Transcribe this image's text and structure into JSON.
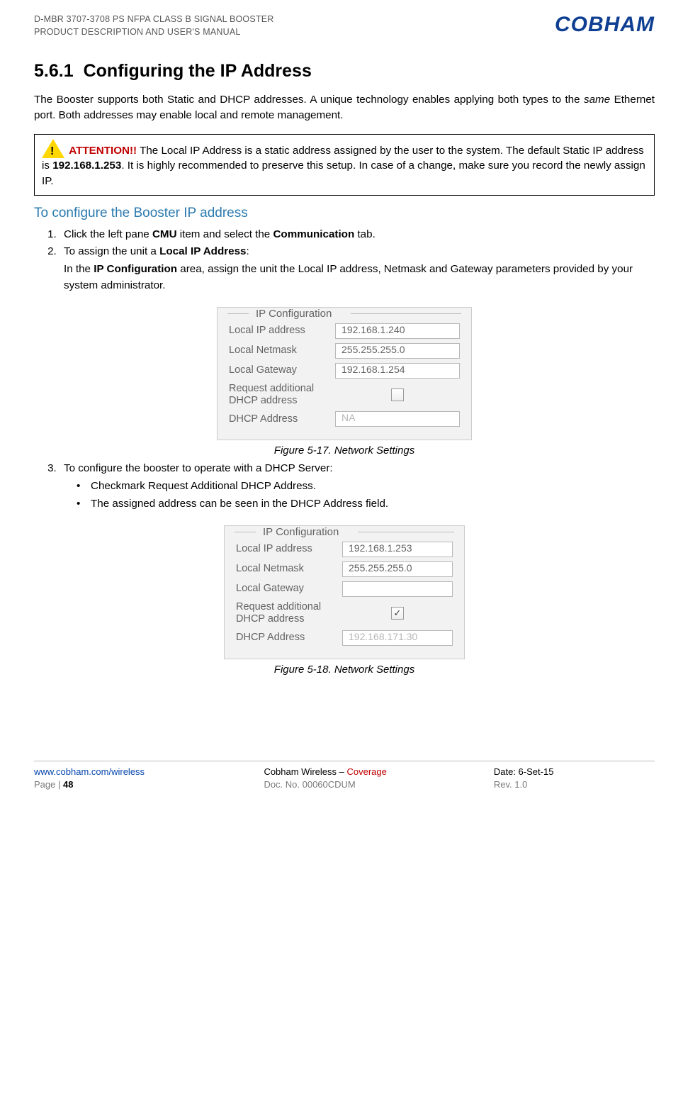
{
  "header": {
    "line1": "D-MBR 3707-3708 PS NFPA CLASS B SIGNAL BOOSTER",
    "line2": "PRODUCT DESCRIPTION AND USER'S MANUAL",
    "logo": "COBHAM"
  },
  "section": {
    "number": "5.6.1",
    "title": "Configuring the IP Address",
    "intro_a": "The Booster supports both Static and DHCP addresses. A unique technology enables applying both types to the ",
    "intro_same": "same",
    "intro_b": " Ethernet port. Both addresses may enable local and remote management."
  },
  "attention": {
    "label": "ATTENTION!!",
    "text_a": " The Local IP Address is a static address assigned by the user to the system. The default Static IP address is ",
    "ip_bold": "192.168.1.253",
    "text_b": ". It is highly recommended to preserve this setup. In case of a change, make sure you record the newly assign IP."
  },
  "subheading": "To configure the Booster IP address",
  "steps": {
    "s1_a": "Click the left pane ",
    "s1_cmu": "CMU",
    "s1_b": " item and select the ",
    "s1_comm": "Communication",
    "s1_c": " tab.",
    "s2_a": "To assign the unit a ",
    "s2_lip": "Local IP Address",
    "s2_b": ":",
    "s2_block_a": "In the ",
    "s2_ipconf": "IP Configuration",
    "s2_block_b": " area, assign the unit the Local IP address, Netmask and Gateway parameters provided by your system administrator.",
    "s3": "To configure the booster to operate with a DHCP Server:",
    "b1": "Checkmark Request Additional DHCP Address.",
    "b2": "The assigned address can be seen in the DHCP Address field."
  },
  "figcap1": "Figure 5-17. Network Settings",
  "figcap2": "Figure 5-18. Network Settings",
  "ipbox": {
    "legend": "IP Configuration",
    "l_ip": "Local IP address",
    "l_nm": "Local Netmask",
    "l_gw": "Local Gateway",
    "l_req": "Request additional DHCP address",
    "l_dhcp": "DHCP Address"
  },
  "fig1": {
    "ip": "192.168.1.240",
    "nm": "255.255.255.0",
    "gw": "192.168.1.254",
    "dhcp": "NA",
    "checked": ""
  },
  "fig2": {
    "ip": "192.168.1.253",
    "nm": "255.255.255.0",
    "gw": "",
    "dhcp": "192.168.171.30",
    "checked": "✓"
  },
  "footer": {
    "url": "www.cobham.com/wireless",
    "mid1a": "Cobham Wireless",
    "mid1b": " – ",
    "mid1c": "Coverage",
    "date": "Date: 6-Set-15",
    "page_a": "Page | ",
    "page_b": "48",
    "doc": "Doc. No. 00060CDUM",
    "rev": "Rev. 1.0"
  }
}
